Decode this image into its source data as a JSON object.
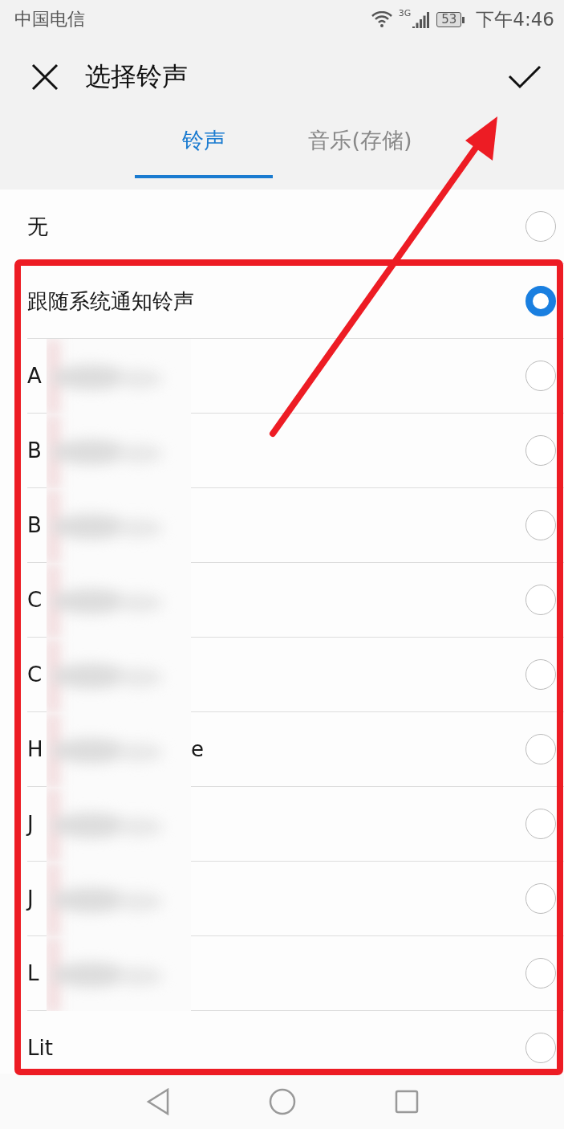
{
  "status_bar": {
    "carrier": "中国电信",
    "network": "3G",
    "battery": "53",
    "time": "下午4:46"
  },
  "header": {
    "title": "选择铃声"
  },
  "tabs": [
    {
      "label": "铃声",
      "selected": true
    },
    {
      "label": "音乐(存储)",
      "selected": false
    }
  ],
  "ringtones": [
    {
      "name": "无",
      "selected": false,
      "blurred": false
    },
    {
      "name": "跟随系统通知铃声",
      "selected": true,
      "blurred": false
    },
    {
      "name": "A",
      "selected": false,
      "blurred": true
    },
    {
      "name": "B",
      "selected": false,
      "blurred": true
    },
    {
      "name": "B",
      "selected": false,
      "blurred": true
    },
    {
      "name": "C",
      "selected": false,
      "blurred": true
    },
    {
      "name": "C",
      "selected": false,
      "blurred": true
    },
    {
      "name": "H",
      "tail": "e",
      "selected": false,
      "blurred": true
    },
    {
      "name": "J",
      "selected": false,
      "blurred": true
    },
    {
      "name": "J",
      "selected": false,
      "blurred": true
    },
    {
      "name": "L",
      "selected": false,
      "blurred": true
    },
    {
      "name": "Lit",
      "selected": false,
      "blurred": false
    }
  ]
}
